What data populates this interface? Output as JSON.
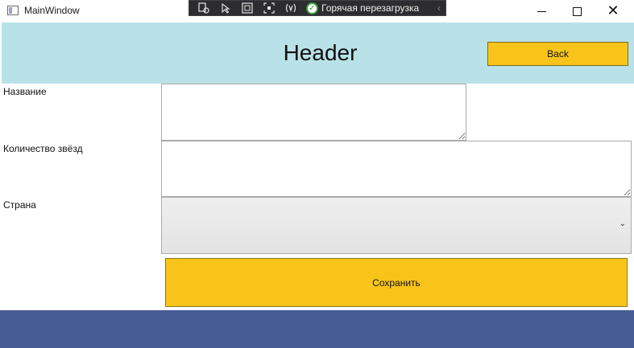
{
  "window": {
    "title": "MainWindow",
    "devtools": {
      "hot_reload_label": "Горячая перезагрузка",
      "icons": [
        "live-visual-tree-icon",
        "select-element-icon",
        "display-layout-adorners-icon",
        "track-focus-icon",
        "binding-failures-icon"
      ]
    }
  },
  "header": {
    "title": "Header",
    "back_label": "Back"
  },
  "form": {
    "name_label": "Название",
    "name_value": "",
    "stars_label": "Количество звёзд",
    "stars_value": "",
    "country_label": "Страна",
    "country_value": "",
    "save_label": "Сохранить"
  },
  "colors": {
    "header_bg": "#b9e2e8",
    "button_bg": "#f9c41a",
    "footer_bg": "#475b95"
  }
}
